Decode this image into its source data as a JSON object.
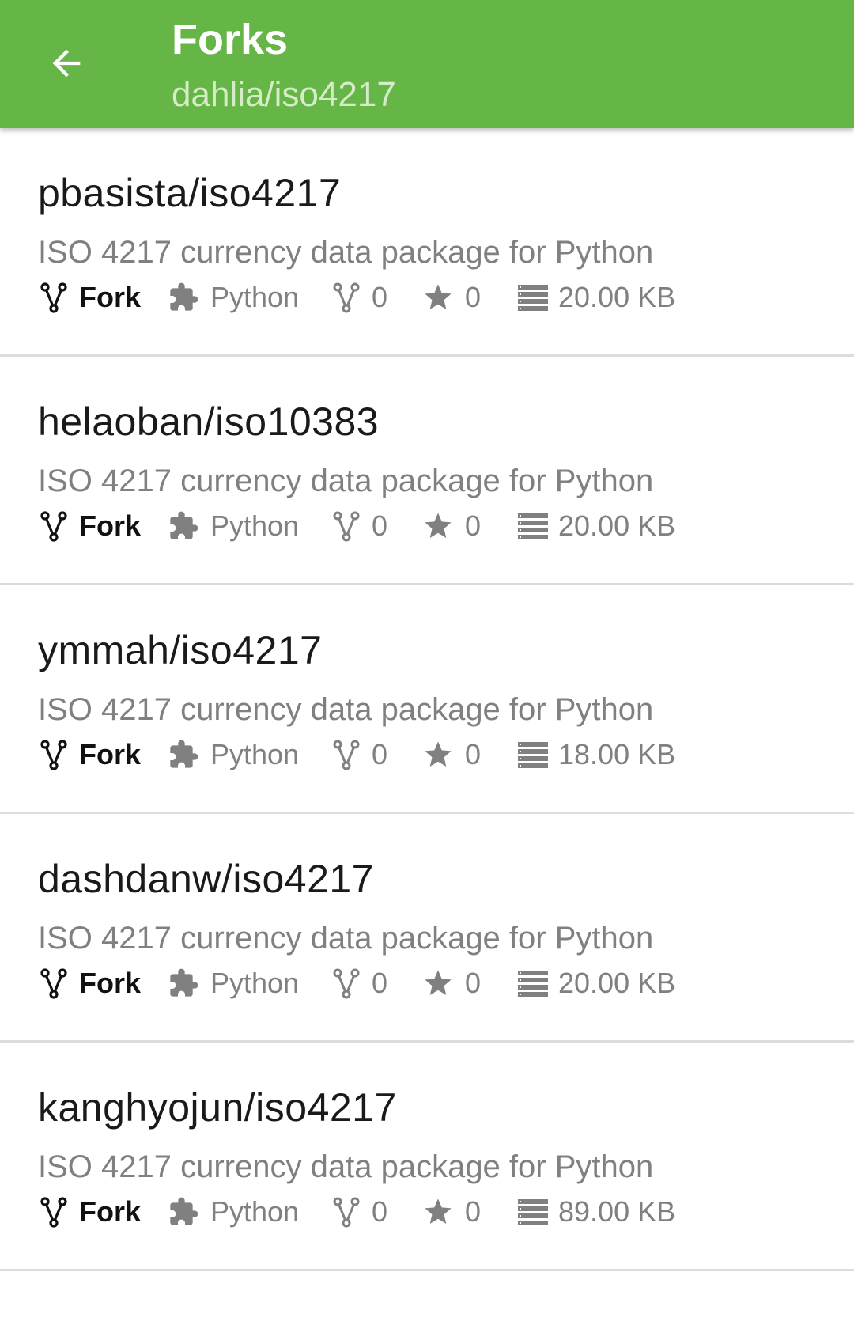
{
  "header": {
    "title": "Forks",
    "subtitle": "dahlia/iso4217"
  },
  "icons": {
    "back": "arrow-back-icon",
    "type": "fork-icon",
    "language": "puzzle-piece-icon",
    "forks": "fork-count-icon",
    "stars": "star-icon",
    "size": "storage-icon"
  },
  "colors": {
    "appbar": "#66b547",
    "subtitle": "#d6ecc7",
    "divider": "#dcdcdc",
    "muted": "#808080"
  },
  "repos": [
    {
      "name": "pbasista/iso4217",
      "description": "ISO 4217 currency data package for Python",
      "type_label": "Fork",
      "language": "Python",
      "forks": "0",
      "stars": "0",
      "size": "20.00 KB"
    },
    {
      "name": "helaoban/iso10383",
      "description": "ISO 4217 currency data package for Python",
      "type_label": "Fork",
      "language": "Python",
      "forks": "0",
      "stars": "0",
      "size": "20.00 KB"
    },
    {
      "name": "ymmah/iso4217",
      "description": "ISO 4217 currency data package for Python",
      "type_label": "Fork",
      "language": "Python",
      "forks": "0",
      "stars": "0",
      "size": "18.00 KB"
    },
    {
      "name": "dashdanw/iso4217",
      "description": "ISO 4217 currency data package for Python",
      "type_label": "Fork",
      "language": "Python",
      "forks": "0",
      "stars": "0",
      "size": "20.00 KB"
    },
    {
      "name": "kanghyojun/iso4217",
      "description": "ISO 4217 currency data package for Python",
      "type_label": "Fork",
      "language": "Python",
      "forks": "0",
      "stars": "0",
      "size": "89.00 KB"
    }
  ]
}
